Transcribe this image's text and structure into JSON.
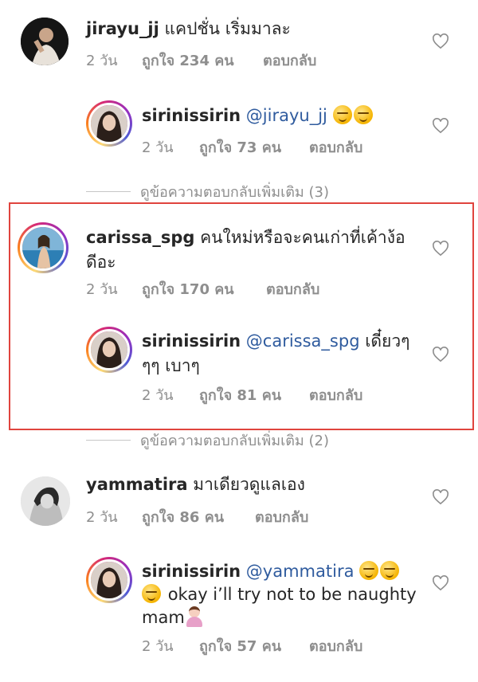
{
  "comments": [
    {
      "username": "jirayu_jj",
      "text": "แคปชั่น เริ่มมาละ",
      "time": "2 วัน",
      "likes": "ถูกใจ 234 คน",
      "reply": "ตอบกลับ",
      "avatar_icon": "profile-photo"
    },
    {
      "username": "sirinissirin",
      "mention": "@jirayu_jj",
      "text": "",
      "emojis": [
        "wink-face",
        "smirk-face"
      ],
      "time": "2 วัน",
      "likes": "ถูกใจ 73 คน",
      "reply": "ตอบกลับ",
      "avatar_icon": "profile-photo-story-ring"
    },
    {
      "username": "carissa_spg",
      "text_line1": "คนใหม่หรือจะคนเก่าที่เค้าง้อ",
      "text_line2": "ดีอะ",
      "time": "2 วัน",
      "likes": "ถูกใจ 170 คน",
      "reply": "ตอบกลับ",
      "avatar_icon": "profile-photo-story-ring"
    },
    {
      "username": "sirinissirin",
      "mention": "@carissa_spg",
      "text_line1": "เดี๋ยวๆ",
      "text_line2": "ๆๆ เบาๆ",
      "time": "2 วัน",
      "likes": "ถูกใจ 81 คน",
      "reply": "ตอบกลับ",
      "avatar_icon": "profile-photo-story-ring"
    },
    {
      "username": "yammatira",
      "text": "มาเดียวดูแลเอง",
      "time": "2 วัน",
      "likes": "ถูกใจ 86 คน",
      "reply": "ตอบกลับ",
      "avatar_icon": "profile-photo"
    },
    {
      "username": "sirinissirin",
      "mention": "@yammatira",
      "text_line2": "okay i’ll try not to be naughty",
      "text_line3": "mam",
      "emojis": [
        "smirk-face",
        "smirk-face",
        "smirk-face",
        "woman-gesturing-ok"
      ],
      "time": "2 วัน",
      "likes": "ถูกใจ 57 คน",
      "reply": "ตอบกลับ",
      "avatar_icon": "profile-photo-story-ring"
    }
  ],
  "view_more_replies": [
    "ดูข้อความตอบกลับเพิ่มเติม (3)",
    "ดูข้อความตอบกลับเพิ่มเติม (2)"
  ],
  "colors": {
    "mention": "#2f5b9e",
    "meta": "#8e8e8e",
    "highlight_border": "#e0443e"
  }
}
